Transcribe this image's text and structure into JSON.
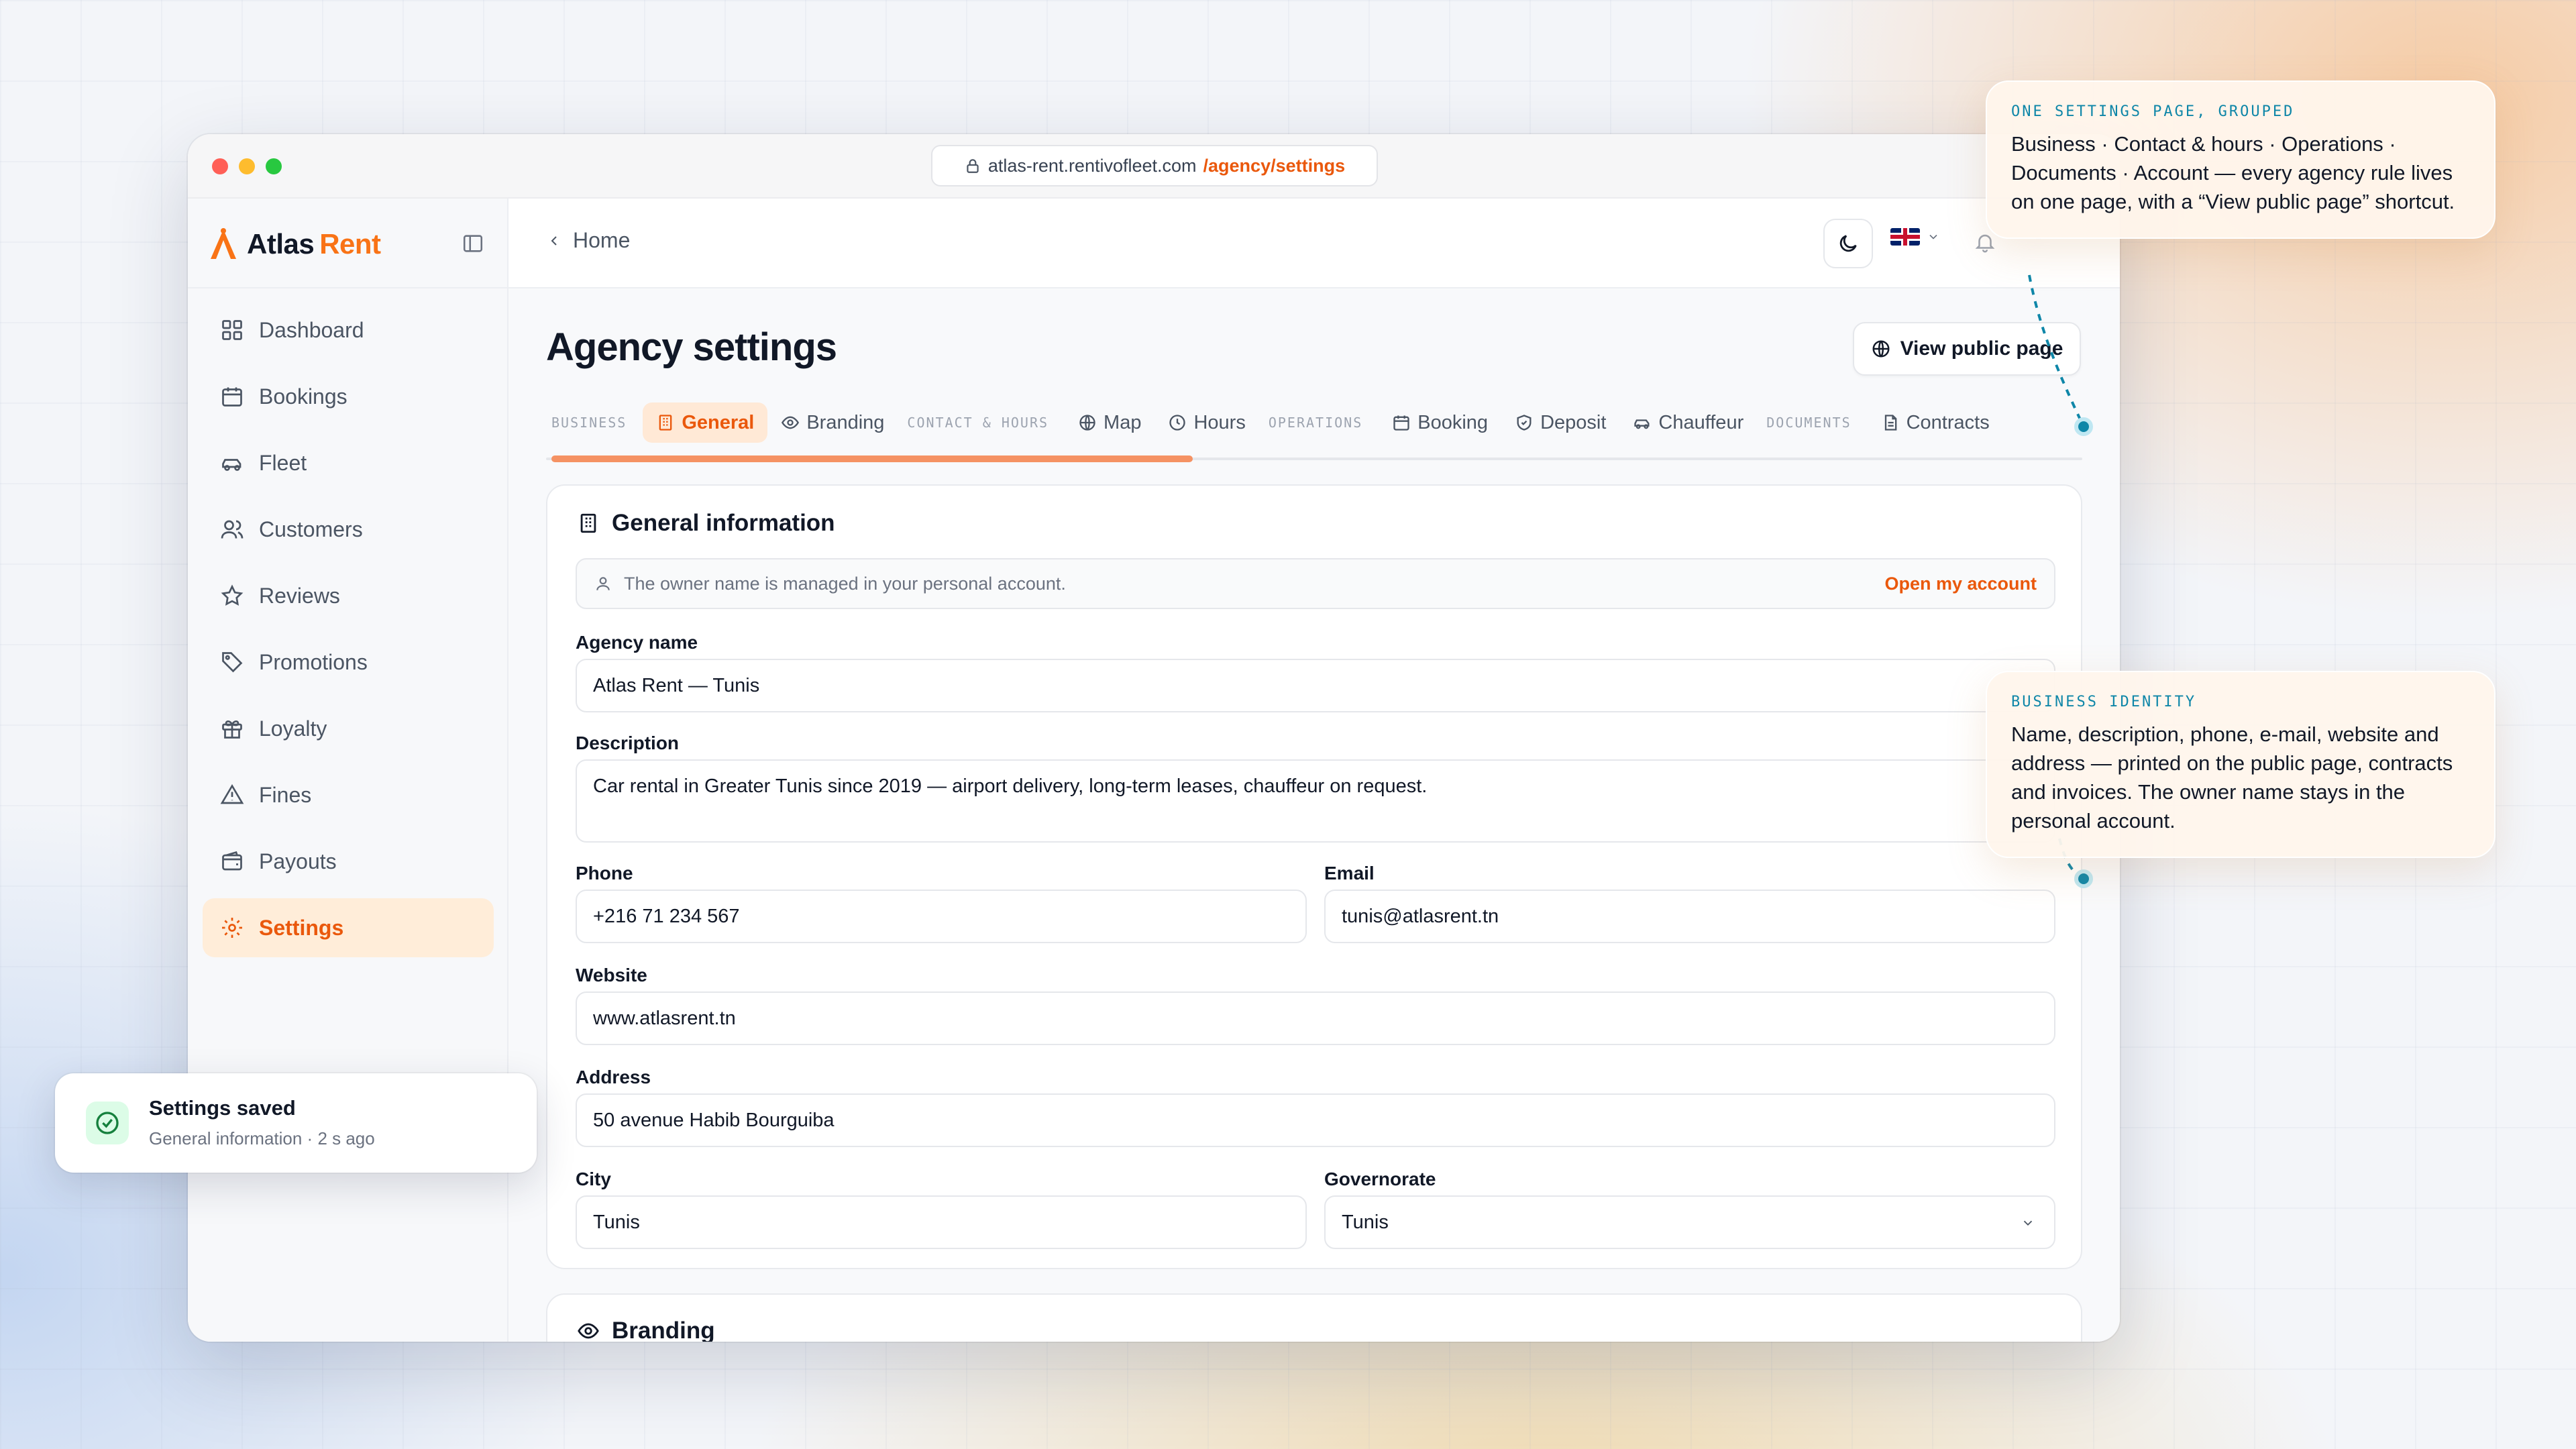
{
  "browser": {
    "url_host": "atlas-rent.rentivofleet.com",
    "url_path": "/agency/settings"
  },
  "brand": {
    "name": "Atlas",
    "name_accent": "Rent"
  },
  "sidebar": {
    "items": [
      {
        "label": "Dashboard",
        "icon": "grid-icon",
        "active": false
      },
      {
        "label": "Bookings",
        "icon": "calendar-icon",
        "active": false
      },
      {
        "label": "Fleet",
        "icon": "car-icon",
        "active": false
      },
      {
        "label": "Customers",
        "icon": "users-icon",
        "active": false
      },
      {
        "label": "Reviews",
        "icon": "star-icon",
        "active": false
      },
      {
        "label": "Promotions",
        "icon": "tag-icon",
        "active": false
      },
      {
        "label": "Loyalty",
        "icon": "gift-icon",
        "active": false
      },
      {
        "label": "Fines",
        "icon": "warning-icon",
        "active": false
      },
      {
        "label": "Payouts",
        "icon": "wallet-icon",
        "active": false
      },
      {
        "label": "Settings",
        "icon": "gear-icon",
        "active": true
      }
    ]
  },
  "header": {
    "breadcrumb": "Home"
  },
  "page": {
    "title": "Agency settings",
    "public_button": "View public page"
  },
  "tabs": {
    "group_business": "BUSINESS",
    "general": "General",
    "branding": "Branding",
    "group_contact": "CONTACT & HOURS",
    "map": "Map",
    "hours": "Hours",
    "group_operations": "OPERATIONS",
    "booking": "Booking",
    "deposit": "Deposit",
    "chauffeur": "Chauffeur",
    "group_documents": "DOCUMENTS",
    "contracts": "Contracts"
  },
  "general": {
    "title": "General information",
    "owner_note": "The owner name is managed in your personal account.",
    "owner_link": "Open my account",
    "agency_name_label": "Agency name",
    "agency_name": "Atlas Rent — Tunis",
    "description_label": "Description",
    "description": "Car rental in Greater Tunis since 2019 — airport delivery, long-term leases, chauffeur on request.",
    "phone_label": "Phone",
    "phone": "+216 71 234 567",
    "email_label": "Email",
    "email": "tunis@atlasrent.tn",
    "website_label": "Website",
    "website": "www.atlasrent.tn",
    "address_label": "Address",
    "address": "50 avenue Habib Bourguiba",
    "city_label": "City",
    "city": "Tunis",
    "governorate_label": "Governorate",
    "governorate": "Tunis"
  },
  "branding_section": {
    "title": "Branding"
  },
  "toast": {
    "title": "Settings saved",
    "subtitle": "General information · 2 s ago"
  },
  "callouts": [
    {
      "kicker": "ONE SETTINGS PAGE, GROUPED",
      "text": "Business · Contact & hours · Operations · Documents · Account — every agency rule lives on one page, with a “View public page” shortcut."
    },
    {
      "kicker": "BUSINESS IDENTITY",
      "text": "Name, description, phone, e-mail, website and address — printed on the public page, contracts and invoices. The owner name stays in the personal account."
    }
  ],
  "colors": {
    "accent": "#ea580c",
    "accent_soft": "#ffedd9",
    "callout_kicker": "#0e86a8",
    "success": "#16a34a"
  }
}
